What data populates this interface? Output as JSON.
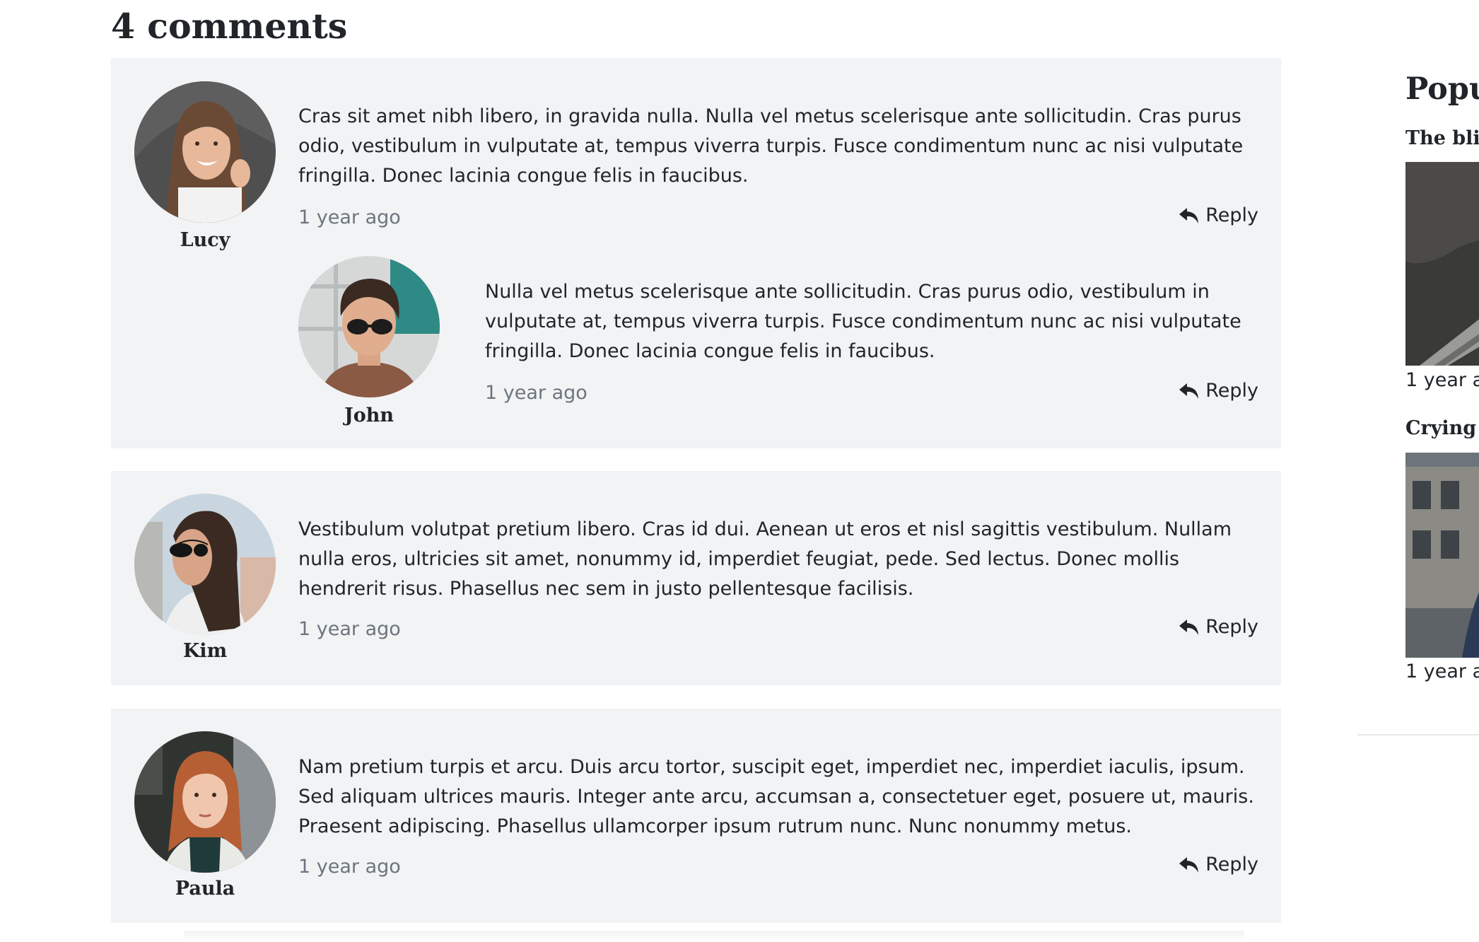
{
  "comments_heading": "4 comments",
  "reply_label": "Reply",
  "comments": [
    {
      "author": "Lucy",
      "avatar": "woman-smiling-portrait",
      "text": "Cras sit amet nibh libero, in gravida nulla. Nulla vel metus scelerisque ante sollicitudin. Cras purus odio, vestibulum in vulputate at, tempus viverra turpis. Fusce condimentum nunc ac nisi vulputate fringilla. Donec lacinia congue felis in faucibus.",
      "time": "1 year ago",
      "replies": [
        {
          "author": "John",
          "avatar": "man-sunglasses-portrait",
          "text": "Nulla vel metus scelerisque ante sollicitudin. Cras purus odio, vestibulum in vulputate at, tempus viverra turpis. Fusce condimentum nunc ac nisi vulputate fringilla. Donec lacinia congue felis in faucibus.",
          "time": "1 year ago"
        }
      ]
    },
    {
      "author": "Kim",
      "avatar": "woman-sunglasses-portrait",
      "text": "Vestibulum volutpat pretium libero. Cras id dui. Aenean ut eros et nisl sagittis vestibulum. Nullam nulla eros, ultricies sit amet, nonummy id, imperdiet feugiat, pede. Sed lectus. Donec mollis hendrerit risus. Phasellus nec sem in justo pellentesque facilisis.",
      "time": "1 year ago"
    },
    {
      "author": "Paula",
      "avatar": "woman-red-hair-portrait",
      "text": "Nam pretium turpis et arcu. Duis arcu tortor, suscipit eget, imperdiet nec, imperdiet iaculis, ipsum. Sed aliquam ultrices mauris. Integer ante arcu, accumsan a, consectetuer eget, posuere ut, mauris. Praesent adipiscing. Phasellus ullamcorper ipsum rutrum nunc. Nunc nonummy metus.",
      "time": "1 year ago"
    }
  ],
  "sidebar": {
    "title": "Popu",
    "posts": [
      {
        "title": "The blir",
        "time": "1 year a"
      },
      {
        "title": "Crying c",
        "time": "1 year a"
      }
    ]
  },
  "colors": {
    "card_bg": "#f2f3f5",
    "text": "#212529",
    "muted": "#6c757d"
  }
}
